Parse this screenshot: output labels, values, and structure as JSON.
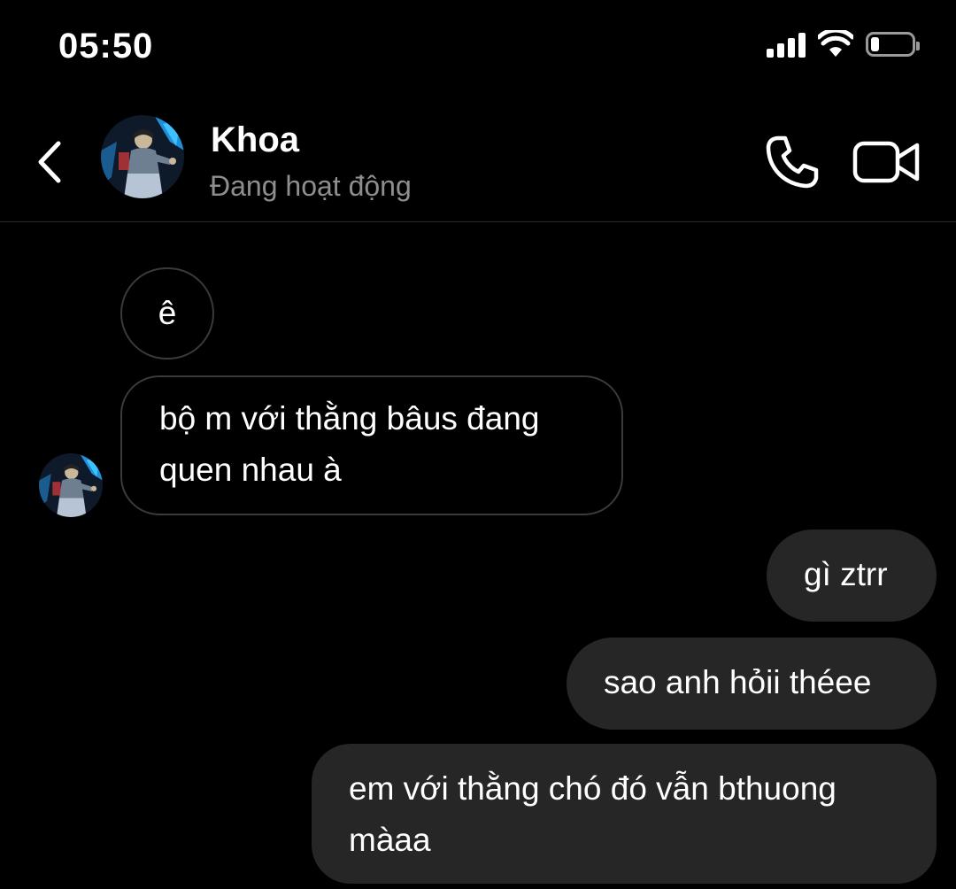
{
  "status_bar": {
    "time": "05:50",
    "battery_level": 0.2
  },
  "header": {
    "contact_name": "Khoa",
    "contact_status": "Đang hoạt động"
  },
  "messages": [
    {
      "sender": "Khoa",
      "text": "ê"
    },
    {
      "sender": "Khoa",
      "line1": "bộ m với thằng bâus đang",
      "line2": "quen nhau à"
    },
    {
      "sender": "me",
      "text": "gì ztrr"
    },
    {
      "sender": "me",
      "text": "sao anh hỏii théee"
    },
    {
      "sender": "me",
      "line1": "em với thằng chó đó vẫn bthuong",
      "line2": "màaa"
    }
  ],
  "colors": {
    "background": "#000000",
    "incoming_border": "#3a3a3a",
    "outgoing_bubble": "#262626",
    "secondary_text": "#8e8e8e"
  }
}
